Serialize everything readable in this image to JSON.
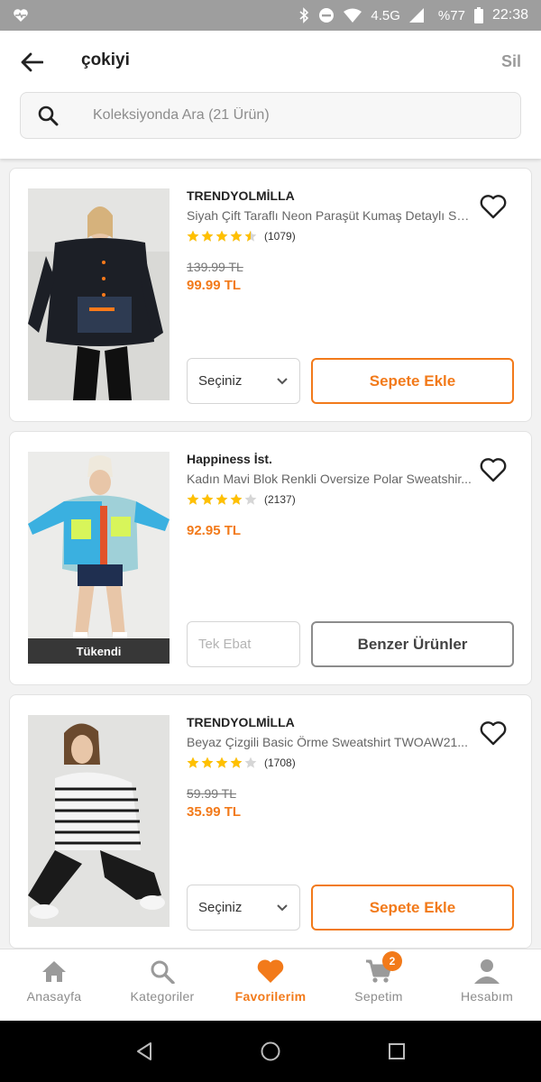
{
  "status_bar": {
    "network": "4.5G",
    "battery": "%77",
    "time": "22:38"
  },
  "header": {
    "title": "çokiyi",
    "clear_label": "Sil",
    "search_placeholder": "Koleksiyonda Ara (21 Ürün)"
  },
  "products": [
    {
      "brand": "TRENDYOLMİLLA",
      "name": "Siyah Çift Taraflı Neon Paraşüt Kumaş Detaylı Sp...",
      "rating": 4.5,
      "rating_count": "(1079)",
      "old_price": "139.99 TL",
      "price": "99.99 TL",
      "size_select": "Seçiniz",
      "action": "Sepete Ekle",
      "sold_out": ""
    },
    {
      "brand": "Happiness İst.",
      "name": "Kadın Mavi Blok Renkli Oversize Polar Sweatshir...",
      "rating": 4,
      "rating_count": "(2137)",
      "old_price": "",
      "price": "92.95 TL",
      "size_select": "Tek Ebat",
      "action": "Benzer Ürünler",
      "sold_out": "Tükendi"
    },
    {
      "brand": "TRENDYOLMİLLA",
      "name": "Beyaz Çizgili Basic Örme Sweatshirt TWOAW21...",
      "rating": 4,
      "rating_count": "(1708)",
      "old_price": "59.99 TL",
      "price": "35.99 TL",
      "size_select": "Seçiniz",
      "action": "Sepete Ekle",
      "sold_out": ""
    }
  ],
  "bottom_nav": {
    "items": [
      {
        "label": "Anasayfa",
        "icon": "home-icon"
      },
      {
        "label": "Kategoriler",
        "icon": "search-icon"
      },
      {
        "label": "Favorilerim",
        "icon": "heart-icon"
      },
      {
        "label": "Sepetim",
        "icon": "cart-icon"
      },
      {
        "label": "Hesabım",
        "icon": "person-icon"
      }
    ],
    "active_index": 2,
    "cart_badge": "2"
  },
  "colors": {
    "accent": "#f27a1a",
    "star": "#ffc000",
    "status_bar": "#9e9e9e"
  }
}
